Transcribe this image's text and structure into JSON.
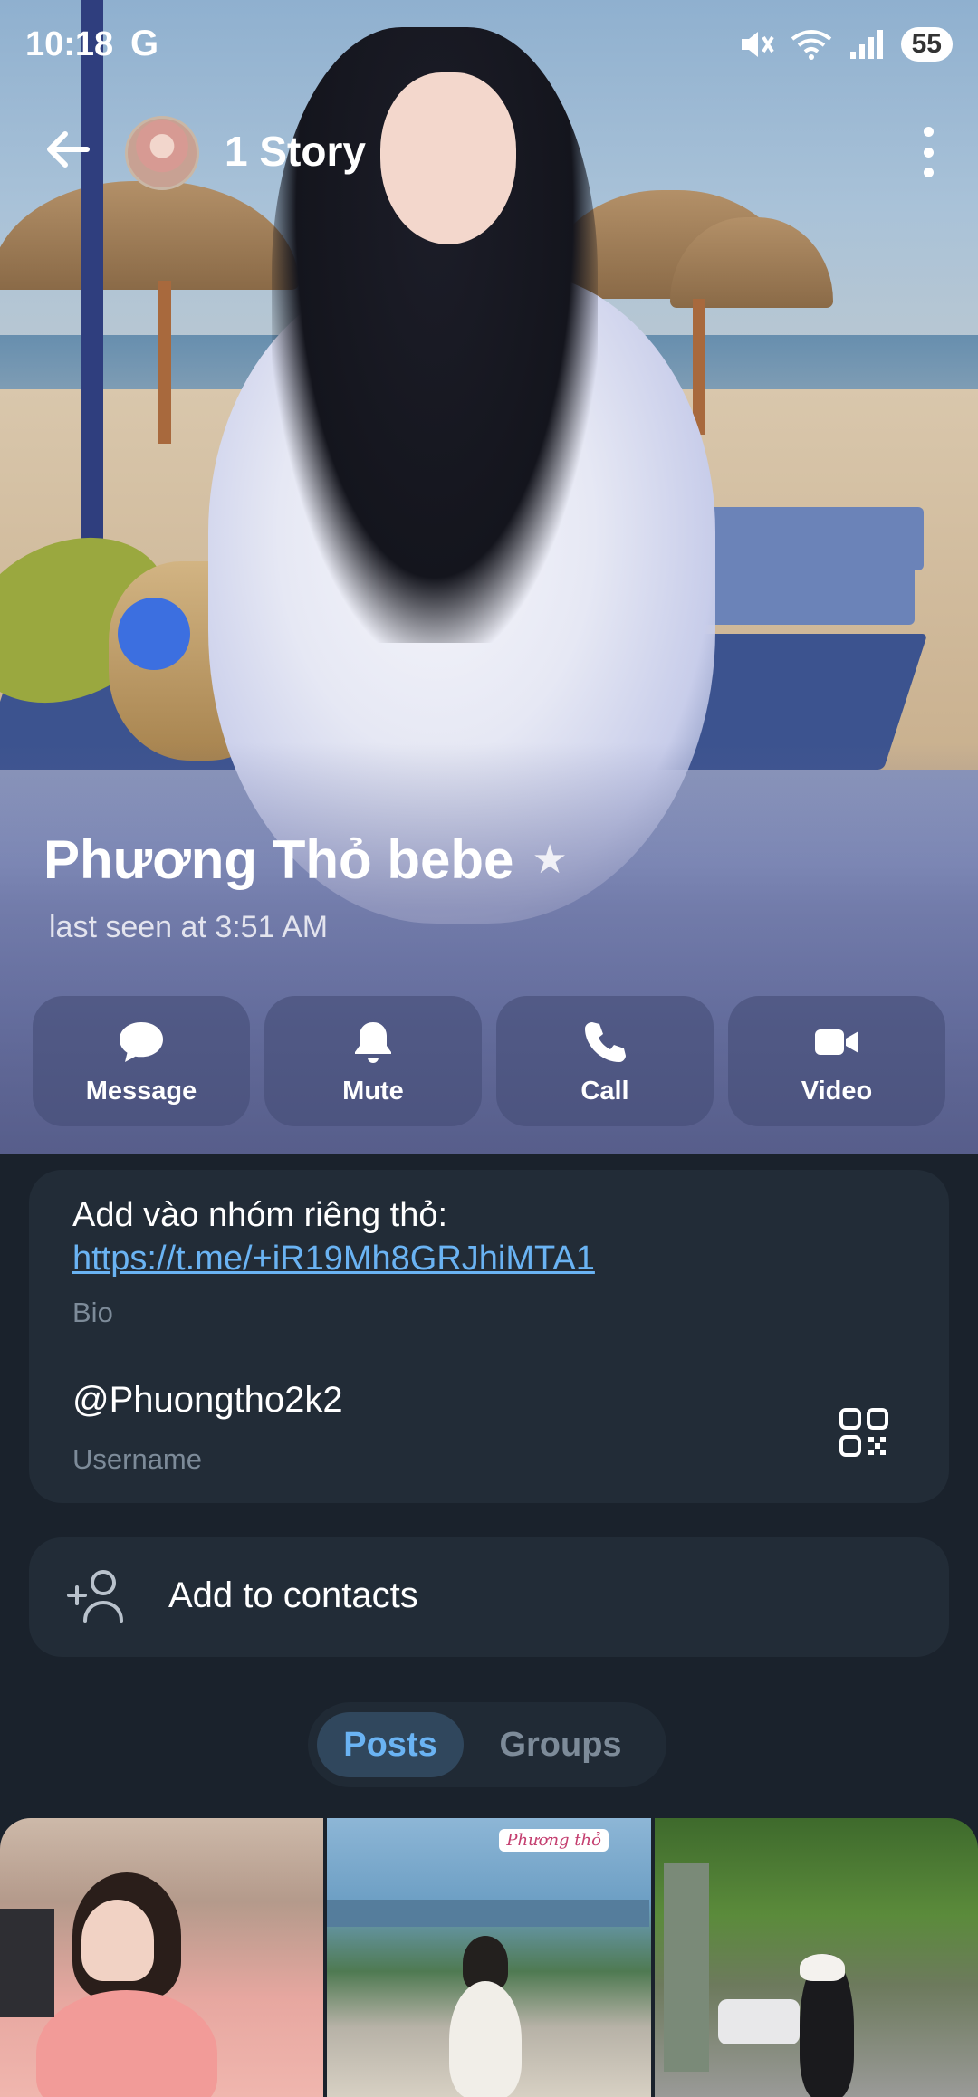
{
  "status_bar": {
    "time": "10:18",
    "carrier_glyph": "G",
    "battery": "55",
    "icons": [
      "mute-icon",
      "wifi-icon",
      "signal-icon"
    ]
  },
  "header": {
    "story_label": "1 Story"
  },
  "profile": {
    "name": "Phương Thỏ bebe",
    "last_seen": "last seen at 3:51 AM"
  },
  "actions": [
    {
      "label": "Message",
      "icon": "message-icon"
    },
    {
      "label": "Mute",
      "icon": "bell-icon"
    },
    {
      "label": "Call",
      "icon": "phone-icon"
    },
    {
      "label": "Video",
      "icon": "video-icon"
    }
  ],
  "info": {
    "bio_text": "Add vào nhóm riêng thỏ:",
    "bio_link": "https://t.me/+iR19Mh8GRJhiMTA1",
    "bio_caption": "Bio",
    "username": "@Phuongtho2k2",
    "username_caption": "Username"
  },
  "add_contact": {
    "label": "Add to contacts"
  },
  "tabs": [
    {
      "label": "Posts",
      "active": true
    },
    {
      "label": "Groups",
      "active": false
    }
  ],
  "posts": {
    "tag_text": "Phương thỏ"
  },
  "colors": {
    "background": "#1a222c",
    "card": "#222c37",
    "accent": "#6ab3f3",
    "caption": "#7d8b99"
  }
}
